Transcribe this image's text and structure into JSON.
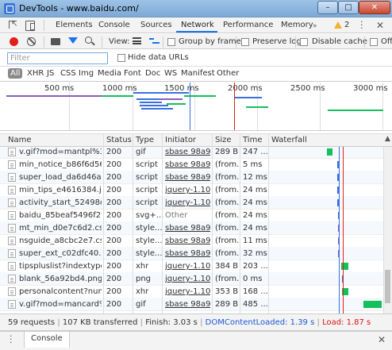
{
  "window": {
    "title": "DevTools - www.baidu.com/"
  },
  "tabs": [
    "Elements",
    "Console",
    "Sources",
    "Network",
    "Performance",
    "Memory"
  ],
  "warnings_count": "2",
  "toolbar": {
    "view_label": "View:",
    "group_by_frame": "Group by frame",
    "preserve_log": "Preserve log",
    "disable_cache": "Disable cache",
    "offline": "Offli"
  },
  "filter": {
    "placeholder": "Filter",
    "value": "",
    "hide_data_urls": "Hide data URLs"
  },
  "types": [
    "All",
    "XHR",
    "JS",
    "CSS",
    "Img",
    "Media",
    "Font",
    "Doc",
    "WS",
    "Manifest",
    "Other"
  ],
  "overview_ticks": [
    "500 ms",
    "1000 ms",
    "1500 ms",
    "2000 ms",
    "2500 ms",
    "3000 ms"
  ],
  "columns": [
    "Name",
    "Status",
    "Type",
    "Initiator",
    "Size",
    "Time",
    "Waterfall"
  ],
  "rows": [
    {
      "name": "v.gif?mod=mantpl%3...",
      "status": "200",
      "type": "gif",
      "initiator": "sbase 98a9...",
      "size": "289 B",
      "time": "247 ..."
    },
    {
      "name": "min_notice_b86f6d56.js",
      "status": "200",
      "type": "script",
      "initiator": "sbase 98a9...",
      "size": "(from...",
      "time": "5 ms"
    },
    {
      "name": "super_load_da6d46a.js",
      "status": "200",
      "type": "script",
      "initiator": "sbase 98a9...",
      "size": "(from...",
      "time": "12 ms"
    },
    {
      "name": "min_tips_e4616384.js",
      "status": "200",
      "type": "script",
      "initiator": "jquery-1.10...",
      "size": "(from...",
      "time": "24 ms"
    },
    {
      "name": "activity_start_52498d2...",
      "status": "200",
      "type": "script",
      "initiator": "jquery-1.10...",
      "size": "(from...",
      "time": "24 ms"
    },
    {
      "name": "baidu_85beaf5496f291...",
      "status": "200",
      "type": "svg+...",
      "initiator": "Other",
      "size": "(from...",
      "time": "24 ms"
    },
    {
      "name": "mt_min_d0e7c6d2.css",
      "status": "200",
      "type": "style...",
      "initiator": "sbase 98a9...",
      "size": "(from...",
      "time": "24 ms"
    },
    {
      "name": "nsguide_a8cbc2e7.css",
      "status": "200",
      "type": "style...",
      "initiator": "sbase 98a9...",
      "size": "(from...",
      "time": "11 ms"
    },
    {
      "name": "super_ext_c02dfc40.css",
      "status": "200",
      "type": "style...",
      "initiator": "sbase 98a9...",
      "size": "(from...",
      "time": "32 ms"
    },
    {
      "name": "tipspluslist?indextype...",
      "status": "200",
      "type": "xhr",
      "initiator": "jquery-1.10...",
      "size": "384 B",
      "time": "203 ..."
    },
    {
      "name": "blank_56a92bd4.png",
      "status": "200",
      "type": "png",
      "initiator": "jquery-1.10...",
      "size": "(from...",
      "time": "0 ms"
    },
    {
      "name": "personalcontent?num...",
      "status": "200",
      "type": "xhr",
      "initiator": "jquery-1.10...",
      "size": "353 B",
      "time": "168 ..."
    },
    {
      "name": "v.gif?mod=mancard%...",
      "status": "200",
      "type": "gif",
      "initiator": "sbase 98a9...",
      "size": "289 B",
      "time": "485 ..."
    }
  ],
  "summary": {
    "requests": "59 requests",
    "transferred": "107 KB transferred",
    "finish": "Finish: 3.03 s",
    "dcl": "DOMContentLoaded: 1.39 s",
    "load": "Load: 1.87 s"
  },
  "drawer": {
    "tab": "Console"
  },
  "colors": {
    "dcl": "#1a57d6",
    "load": "#dd1111",
    "accent": "#1a73e8",
    "bar_green": "#13c05a",
    "bar_blue": "#3b6fe0"
  }
}
